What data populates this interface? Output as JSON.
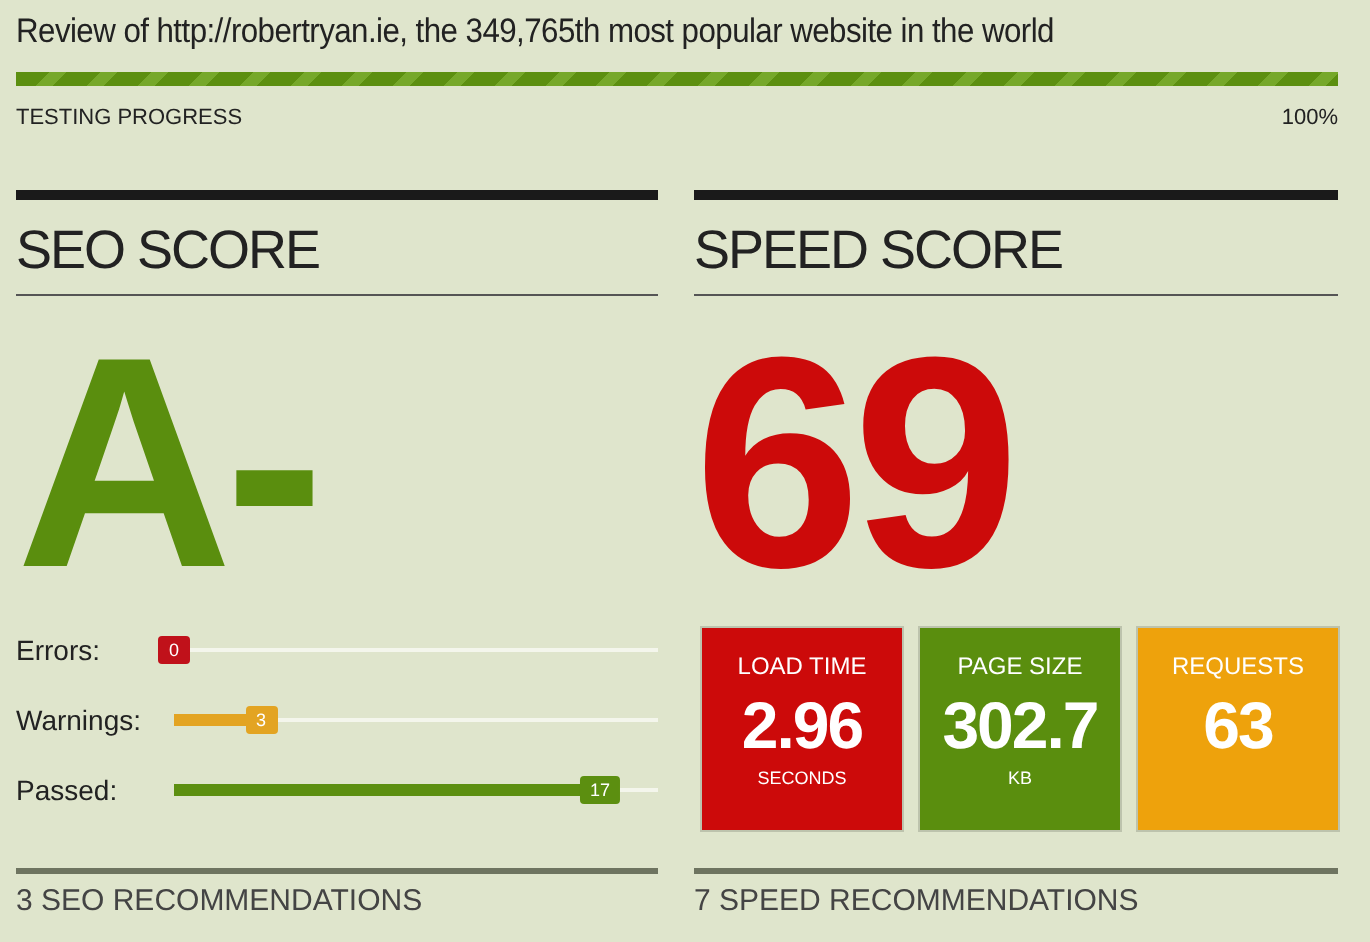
{
  "title": "Review of http://robertryan.ie, the 349,765th most popular website in the world",
  "progress": {
    "label": "TESTING PROGRESS",
    "level": 1,
    "reading": "100%"
  },
  "seo": {
    "heading": "SEO SCORE",
    "grade": "A-",
    "metrics": [
      {
        "label": "Errors:",
        "count": "0",
        "level": 0,
        "color": "#c0111a"
      },
      {
        "label": "Warnings:",
        "count": "3",
        "level": 0.18,
        "color": "#e3a422"
      },
      {
        "label": "Passed:",
        "count": "17",
        "level": 0.88,
        "color": "#5c8f10"
      }
    ],
    "recommendations": "3 SEO RECOMMENDATIONS"
  },
  "speed": {
    "heading": "SPEED SCORE",
    "score": "69",
    "tiles": [
      {
        "label": "LOAD TIME",
        "value": "2.96",
        "unit": "SECONDS",
        "color": "#cc0a0a"
      },
      {
        "label": "PAGE SIZE",
        "value": "302.7",
        "unit": "KB",
        "color": "#5a8e0e"
      },
      {
        "label": "REQUESTS",
        "value": "63",
        "color": "#eea20c"
      }
    ],
    "recommendations": "7 SPEED RECOMMENDATIONS"
  }
}
